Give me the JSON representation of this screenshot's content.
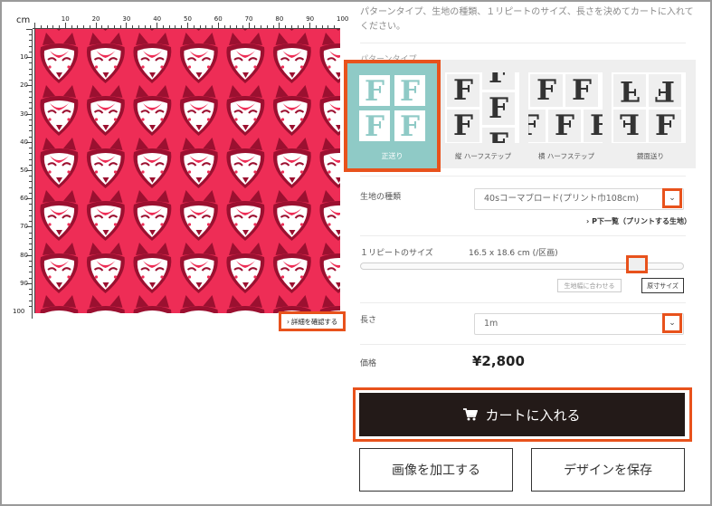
{
  "preview": {
    "unit": "cm",
    "x_ticks": [
      "10",
      "20",
      "30",
      "40",
      "50",
      "60",
      "70",
      "80",
      "90",
      "100"
    ],
    "y_ticks": [
      "10",
      "20",
      "30",
      "40",
      "50",
      "60",
      "70",
      "80",
      "90",
      "100"
    ],
    "detail_button": "› 詳細を確認する",
    "pattern_colors": {
      "background": "#ee2d56",
      "face": "#ffffff",
      "accent": "#9b1030"
    }
  },
  "intro": "パターンタイプ、生地の種類、１リピートのサイズ、長さを決めてカートに入れてください。",
  "pattern_type": {
    "label": "パターンタイプ",
    "options": [
      {
        "label": "正送り",
        "selected": true
      },
      {
        "label": "縦 ハーフステップ",
        "selected": false
      },
      {
        "label": "横 ハーフステップ",
        "selected": false
      },
      {
        "label": "鏡面送り",
        "selected": false
      }
    ],
    "letter": "F"
  },
  "fabric": {
    "label": "生地の種類",
    "value": "40sコーマブロード(プリント巾108cm)",
    "link": "› P下一覧（プリントする生地）",
    "icon": "chevron-down-icon"
  },
  "repeat_size": {
    "label": "１リピートのサイズ",
    "value": "16.5 x 18.6 cm (/区画)",
    "slider_level": 0.88,
    "fit_button": "生地幅に合わせる",
    "actual_button": "原寸サイズ"
  },
  "length": {
    "label": "長さ",
    "value": "1m",
    "icon": "chevron-down-icon"
  },
  "price": {
    "label": "価格",
    "value": "¥2,800"
  },
  "actions": {
    "cart": "カートに入れる",
    "cart_icon": "cart-icon",
    "edit": "画像を加工する",
    "save": "デザインを保存"
  },
  "highlight_color": "#e8521c"
}
